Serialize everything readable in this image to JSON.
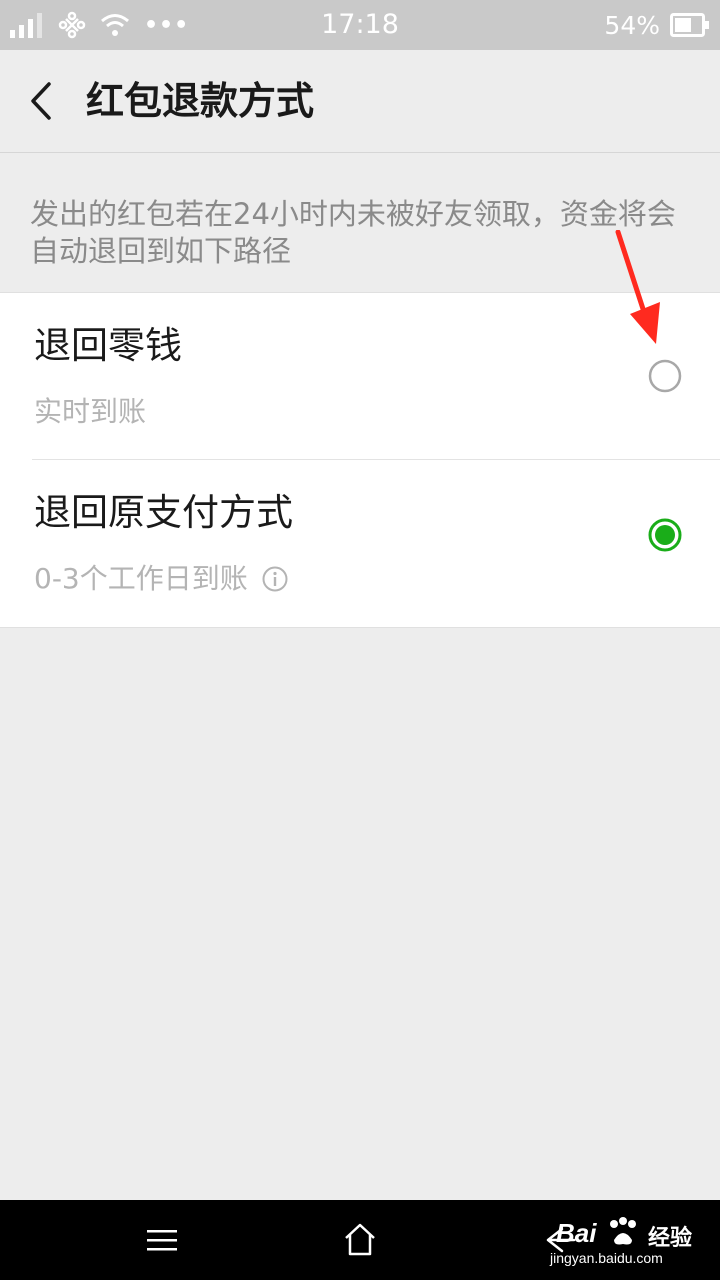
{
  "status_bar": {
    "time": "17:18",
    "battery": "54%",
    "dots": "•••",
    "icons": [
      "signal-icon",
      "unicom-icon",
      "wifi-icon",
      "battery-icon"
    ]
  },
  "header": {
    "title": "红包退款方式",
    "back_icon": "chevron-left-icon"
  },
  "description": "发出的红包若在24小时内未被好友领取，资金将会自动退回到如下路径",
  "options": [
    {
      "title": "退回零钱",
      "subtitle": "实时到账",
      "selected": false
    },
    {
      "title": "退回原支付方式",
      "subtitle": "0-3个工作日到账",
      "selected": true,
      "info_icon": "info-icon"
    }
  ],
  "colors": {
    "accent": "#1aad19",
    "annotation_arrow": "#ff2a1f",
    "status_bar_bg": "#c9c9c9",
    "page_bg": "#ededed"
  },
  "navigation": {
    "icons": [
      "menu-icon",
      "home-icon",
      "back-arrow-icon"
    ]
  },
  "watermark": {
    "brand": "Bai",
    "brand_suffix": "经验",
    "url": "jingyan.baidu.com"
  }
}
